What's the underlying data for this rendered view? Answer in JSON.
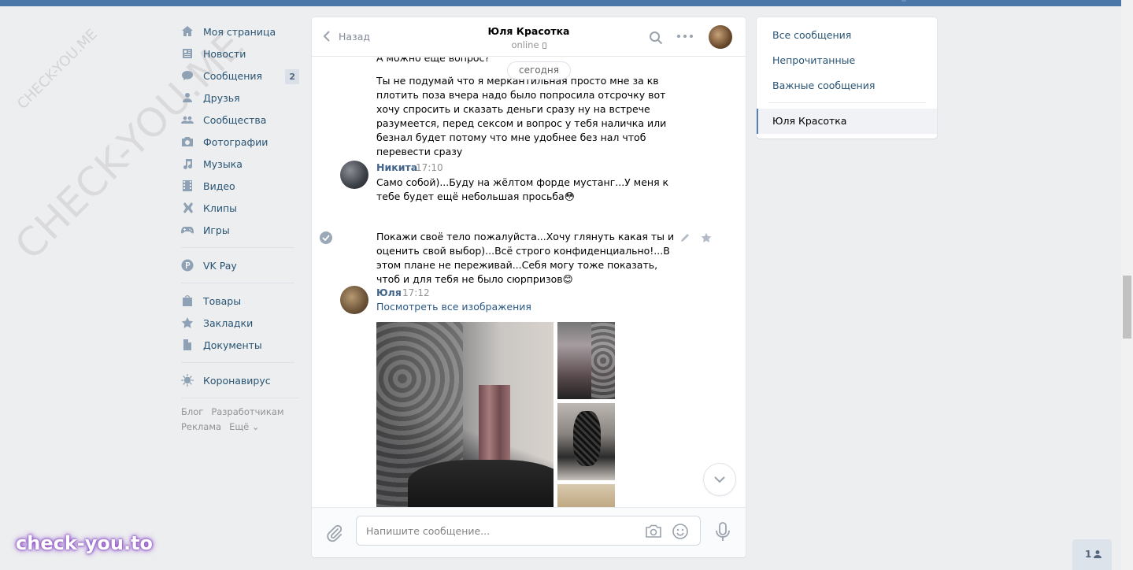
{
  "nav": {
    "items": [
      {
        "label": "Моя страница",
        "icon": "home-icon"
      },
      {
        "label": "Новости",
        "icon": "news-icon"
      },
      {
        "label": "Сообщения",
        "icon": "messages-icon",
        "badge": "2"
      },
      {
        "label": "Друзья",
        "icon": "friend-icon"
      },
      {
        "label": "Сообщества",
        "icon": "groups-icon"
      },
      {
        "label": "Фотографии",
        "icon": "camera-icon"
      },
      {
        "label": "Музыка",
        "icon": "music-icon"
      },
      {
        "label": "Видео",
        "icon": "video-icon"
      },
      {
        "label": "Клипы",
        "icon": "clips-icon"
      },
      {
        "label": "Игры",
        "icon": "gamepad-icon"
      },
      {
        "label": "VK Pay",
        "icon": "vkpay-icon"
      },
      {
        "label": "Товары",
        "icon": "bag-icon"
      },
      {
        "label": "Закладки",
        "icon": "star-icon"
      },
      {
        "label": "Документы",
        "icon": "document-icon"
      },
      {
        "label": "Коронавирус",
        "icon": "virus-icon"
      }
    ],
    "footer": {
      "blog": "Блог",
      "dev": "Разработчикам",
      "ads": "Реклама",
      "more": "Ещё ⌄"
    }
  },
  "watermark": {
    "big": "CHECK-YOU.ME",
    "small": "CHECK-YOU.ME",
    "bottom": "check-you.to"
  },
  "chat": {
    "back_label": "Назад",
    "peer_name": "Юля Красотка",
    "peer_status": "online",
    "day_label": "сегодня",
    "messages": [
      {
        "text": "А можно еще вопрос?"
      },
      {
        "text": "Ты не подумай что я меркантильная просто мне за кв плотить поза вчера надо было попросила отсрочку вот хочу спросить и сказать деньги сразу ну на встрече разумеется, перед сексом и вопрос у тебя наличка или безнал будет потому что мне удобнее без нал чтоб перевести сразу"
      },
      {
        "author": "Никита",
        "time": "17:10",
        "text": "Само собой)...Буду на жёлтом форде мустанг...У меня к тебе будет ещё небольшая просьба😳"
      },
      {
        "text": "Покажи своё тело пожалуйста...Хочу глянуть какая ты и оценить свой выбор)...Всё строго конфиденциально!...В этом плане не переживай...Себя могу тоже показать, чтоб и для тебя не было сюрпризов😊"
      },
      {
        "author": "Юля",
        "time": "17:12",
        "link": "Посмотреть все изображения"
      }
    ],
    "composer": {
      "placeholder": "Напишите сообщение..."
    }
  },
  "right_panel": {
    "items": [
      "Все сообщения",
      "Непрочитанные",
      "Важные сообщения"
    ],
    "active": "Юля Красотка"
  },
  "corner_counter": "1",
  "colors": {
    "brand": "#4a76a8",
    "link": "#2a5885",
    "nav_text": "#285473"
  }
}
